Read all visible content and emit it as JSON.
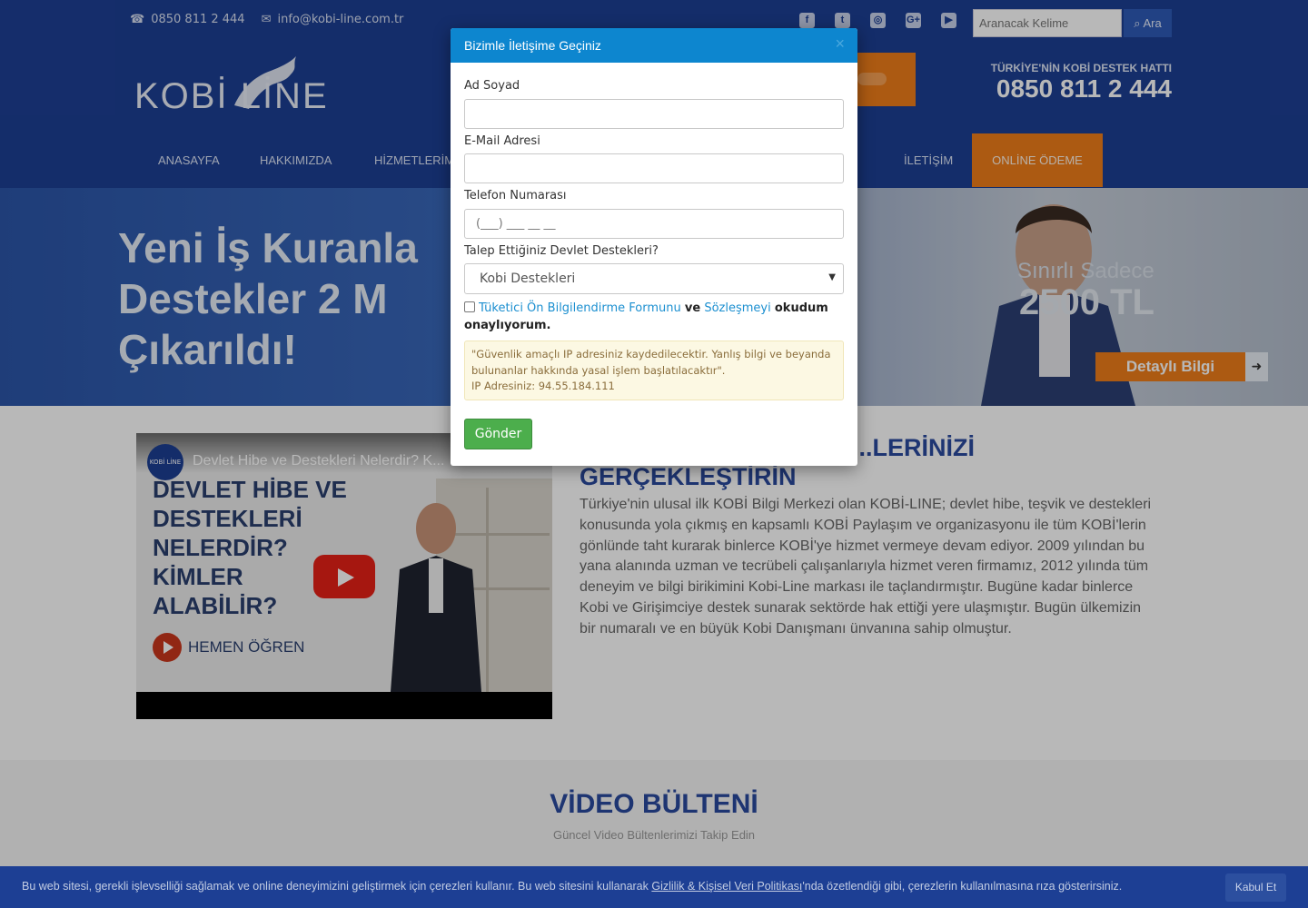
{
  "topbar": {
    "phone": "0850 811 2 444",
    "email": "info@kobi-line.com.tr",
    "social_icons": [
      "facebook-icon",
      "twitter-icon",
      "instagram-icon",
      "google-plus-icon",
      "youtube-icon"
    ],
    "search_placeholder": "Aranacak Kelime",
    "search_button": "Ara"
  },
  "brand": {
    "logo_text": "KOBİ LİNE",
    "hotline_label": "TÜRKİYE'NİN KOBİ DESTEK HATTI",
    "hotline_number": "0850 811 2 444"
  },
  "nav": {
    "items": [
      {
        "label": "ANASAYFA"
      },
      {
        "label": "HAKKIMIZDA"
      },
      {
        "label": "HİZMETLERİM"
      },
      {
        "label": "İLETİŞİM"
      }
    ],
    "online_payment": "ONLİNE ÖDEME"
  },
  "hero": {
    "headline_lines": [
      "Yeni İş Kuranla",
      "Destekler 2 M",
      "Çıkarıldı!"
    ],
    "side_line1": "Sınırlı Sadece",
    "side_line2": "2500 TL",
    "button_label": "Detaylı Bilgi"
  },
  "video": {
    "title": "Devlet Hibe ve Destekleri Nelerdir? K...",
    "channel": "KOBİ LİNE",
    "big_text": "DEVLET HİBE VE DESTEKLERİ NELERDİR? KİMLER ALABİLİR?",
    "cta": "HEMEN ÖĞREN"
  },
  "about": {
    "title_line1": "...LERİNİZİ",
    "title_line2": "GERÇEKLEŞTİRİN",
    "text": "Türkiye'nin ulusal ilk KOBİ Bilgi Merkezi olan KOBİ-LINE; devlet hibe, teşvik ve destekleri konusunda yola çıkmış en kapsamlı KOBİ Paylaşım ve organizasyonu ile tüm KOBİ'lerin gönlünde taht kurarak binlerce KOBİ'ye hizmet vermeye devam ediyor. 2009 yılından bu yana alanında uzman ve tecrübeli çalışanlarıyla hizmet veren firmamız, 2012 yılında tüm deneyim ve bilgi birikimini Kobi-Line markası ile taçlandırmıştır. Bugüne kadar binlerce Kobi ve Girişimciye destek sunarak sektörde hak ettiği yere ulaşmıştır. Bugün ülkemizin bir numaralı ve en büyük Kobi Danışmanı ünvanına sahip olmuştur."
  },
  "bulletin": {
    "title": "VİDEO BÜLTENİ",
    "subtitle": "Güncel Video Bültenlerimizi Takip Edin"
  },
  "modal": {
    "title": "Bizimle İletişime Geçiniz",
    "close": "×",
    "name_label": "Ad Soyad",
    "name_value": "",
    "email_label": "E-Mail Adresi",
    "email_value": "",
    "phone_label": "Telefon Numarası",
    "phone_mask": "(___) ___ __ __",
    "support_label": "Talep Ettiğiniz Devlet Destekleri?",
    "support_selected": "Kobi Destekleri",
    "consent_link1": "Tüketici Ön Bilgilendirme Formunu",
    "consent_and": "ve",
    "consent_link2": "Sözleşmeyi",
    "consent_tail": "okudum onaylıyorum.",
    "warning_text": "\"Güvenlik amaçlı IP adresiniz kaydedilecektir. Yanlış bilgi ve beyanda bulunanlar hakkında yasal işlem başlatılacaktır\".",
    "ip_line": "IP Adresiniz: 94.55.184.111",
    "submit": "Gönder"
  },
  "cookie": {
    "text_before": "Bu web sitesi, gerekli işlevselliği sağlamak ve online deneyimizini geliştirmek için çerezleri kullanır. Bu web sitesini kullanarak ",
    "link": "Gizlilik & Kişisel Veri Politikası",
    "text_after": "'nda özetlendiği gibi, çerezlerin kullanılmasına rıza gösterirsiniz.",
    "button": "Kabul Et"
  }
}
